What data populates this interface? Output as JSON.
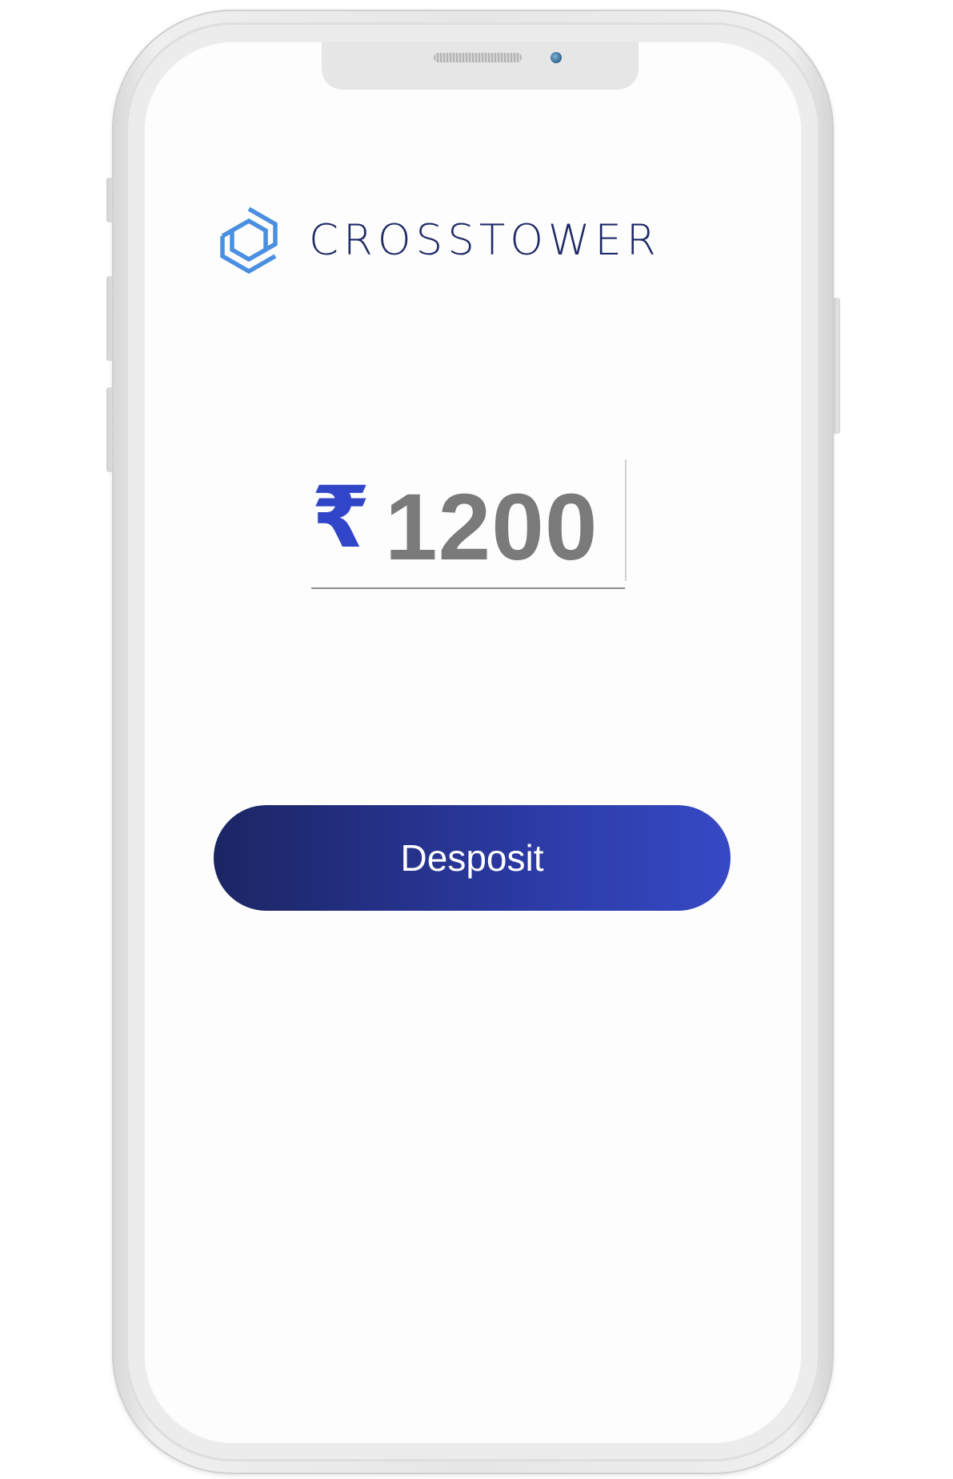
{
  "brand": {
    "name": "CROSSTOWER",
    "logo_icon": "hexagon-logo-icon",
    "text_color": "#1f2a66",
    "icon_color": "#4a8fe0"
  },
  "deposit_form": {
    "currency_symbol": "₹",
    "amount": "1200",
    "currency_color": "#3145c9",
    "amount_color": "#7a7a7a"
  },
  "actions": {
    "deposit_label": "Desposit",
    "button_gradient": [
      "#1c2563",
      "#3649c4"
    ]
  }
}
